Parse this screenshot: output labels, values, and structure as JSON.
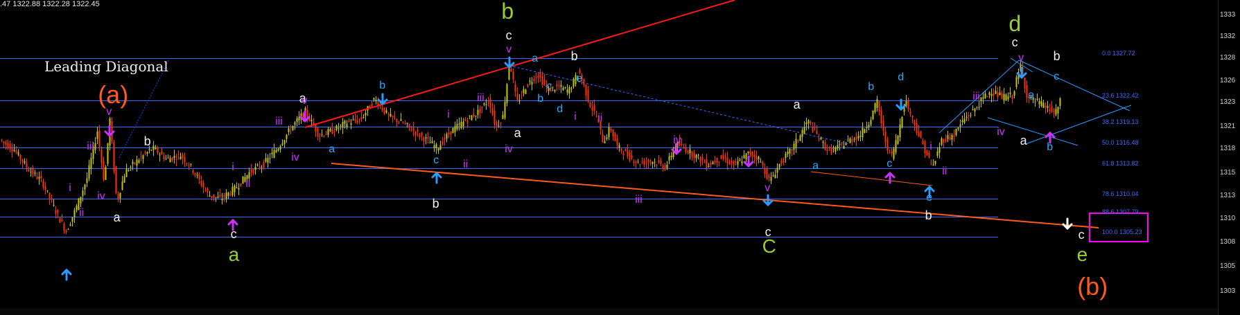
{
  "header": {
    "ohlc_text": ".47 1322.88 1322.28 1322.45"
  },
  "annotation": {
    "diagram_label": "Leading Diagonal"
  },
  "y_axis_ticks": [
    "1333",
    "1332",
    "1328",
    "1326",
    "1323",
    "1321",
    "1318",
    "1315",
    "1313",
    "1310",
    "1308",
    "1305",
    "1303"
  ],
  "fib_levels": [
    {
      "ratio": "0.0",
      "price": 1327.72,
      "label": "0.0 1327.72"
    },
    {
      "ratio": "23.6",
      "price": 1322.42,
      "label": "23.6 1322.42"
    },
    {
      "ratio": "38.2",
      "price": 1319.13,
      "label": "38.2 1319.13"
    },
    {
      "ratio": "50.0",
      "price": 1316.48,
      "label": "50.0 1316.48"
    },
    {
      "ratio": "61.8",
      "price": 1313.82,
      "label": "61.8 1313.82"
    },
    {
      "ratio": "78.6",
      "price": 1310.04,
      "label": "78.6 1310.04"
    },
    {
      "ratio": "88.6",
      "price": 1307.79,
      "label": "88.6 1307.79"
    },
    {
      "ratio": "100.0",
      "price": 1305.23,
      "label": "100.0 1305.23"
    }
  ],
  "wave_labels": [
    {
      "text": "(a)",
      "color": "#ff5a1f",
      "size": 36,
      "x": 152,
      "y": 150
    },
    {
      "text": "(b)",
      "color": "#ff5a1f",
      "size": 36,
      "x": 1565,
      "y": 427
    },
    {
      "text": "b",
      "color": "#9acd32",
      "size": 32,
      "x": 733,
      "y": 27
    },
    {
      "text": "d",
      "color": "#9acd32",
      "size": 32,
      "x": 1465,
      "y": 45
    },
    {
      "text": "a",
      "color": "#9acd32",
      "size": 28,
      "x": 338,
      "y": 378
    },
    {
      "text": "C",
      "color": "#9acd32",
      "size": 28,
      "x": 1108,
      "y": 366
    },
    {
      "text": "e",
      "color": "#9acd32",
      "size": 28,
      "x": 1562,
      "y": 378
    },
    {
      "text": "c",
      "color": "#f0f0f0",
      "size": 18,
      "x": 735,
      "y": 57
    },
    {
      "text": "b",
      "color": "#f0f0f0",
      "size": 18,
      "x": 829,
      "y": 87
    },
    {
      "text": "a",
      "color": "#f0f0f0",
      "size": 18,
      "x": 437,
      "y": 148
    },
    {
      "text": "b",
      "color": "#f0f0f0",
      "size": 18,
      "x": 213,
      "y": 210
    },
    {
      "text": "a",
      "color": "#f0f0f0",
      "size": 18,
      "x": 169,
      "y": 320
    },
    {
      "text": "c",
      "color": "#f0f0f0",
      "size": 18,
      "x": 338,
      "y": 344
    },
    {
      "text": "b",
      "color": "#f0f0f0",
      "size": 18,
      "x": 629,
      "y": 300
    },
    {
      "text": "a",
      "color": "#f0f0f0",
      "size": 18,
      "x": 747,
      "y": 198
    },
    {
      "text": "a",
      "color": "#f0f0f0",
      "size": 18,
      "x": 1150,
      "y": 157
    },
    {
      "text": "c",
      "color": "#f0f0f0",
      "size": 18,
      "x": 1109,
      "y": 341
    },
    {
      "text": "b",
      "color": "#f0f0f0",
      "size": 18,
      "x": 1340,
      "y": 317
    },
    {
      "text": "c",
      "color": "#f0f0f0",
      "size": 18,
      "x": 1465,
      "y": 67
    },
    {
      "text": "b",
      "color": "#f0f0f0",
      "size": 18,
      "x": 1525,
      "y": 87
    },
    {
      "text": "a",
      "color": "#f0f0f0",
      "size": 18,
      "x": 1477,
      "y": 209
    },
    {
      "text": "c",
      "color": "#f0f0f0",
      "size": 18,
      "x": 1561,
      "y": 345
    },
    {
      "text": "v",
      "color": "#cc33ff",
      "size": 16,
      "x": 158,
      "y": 168
    },
    {
      "text": "iii",
      "color": "#cc33ff",
      "size": 16,
      "x": 130,
      "y": 218
    },
    {
      "text": "i",
      "color": "#cc33ff",
      "size": 16,
      "x": 104,
      "y": 278
    },
    {
      "text": "iv",
      "color": "#cc33ff",
      "size": 16,
      "x": 145,
      "y": 290
    },
    {
      "text": "ii",
      "color": "#cc33ff",
      "size": 16,
      "x": 119,
      "y": 314
    },
    {
      "text": "v",
      "color": "#cc33ff",
      "size": 16,
      "x": 440,
      "y": 152
    },
    {
      "text": "iii",
      "color": "#cc33ff",
      "size": 16,
      "x": 402,
      "y": 182
    },
    {
      "text": "iv",
      "color": "#cc33ff",
      "size": 16,
      "x": 425,
      "y": 234
    },
    {
      "text": "i",
      "color": "#cc33ff",
      "size": 16,
      "x": 339,
      "y": 248
    },
    {
      "text": "ii",
      "color": "#cc33ff",
      "size": 16,
      "x": 359,
      "y": 272
    },
    {
      "text": "v",
      "color": "#cc33ff",
      "size": 16,
      "x": 735,
      "y": 78
    },
    {
      "text": "iii",
      "color": "#cc33ff",
      "size": 16,
      "x": 693,
      "y": 148
    },
    {
      "text": "i",
      "color": "#cc33ff",
      "size": 16,
      "x": 650,
      "y": 172
    },
    {
      "text": "ii",
      "color": "#cc33ff",
      "size": 16,
      "x": 673,
      "y": 244
    },
    {
      "text": "iv",
      "color": "#cc33ff",
      "size": 16,
      "x": 733,
      "y": 222
    },
    {
      "text": "i",
      "color": "#cc33ff",
      "size": 16,
      "x": 833,
      "y": 175
    },
    {
      "text": "ii",
      "color": "#cc33ff",
      "size": 16,
      "x": 867,
      "y": 177
    },
    {
      "text": "iv",
      "color": "#cc33ff",
      "size": 16,
      "x": 976,
      "y": 209
    },
    {
      "text": "iii",
      "color": "#cc33ff",
      "size": 16,
      "x": 921,
      "y": 295
    },
    {
      "text": "v",
      "color": "#cc33ff",
      "size": 16,
      "x": 1108,
      "y": 278
    },
    {
      "text": "iii",
      "color": "#cc33ff",
      "size": 16,
      "x": 1408,
      "y": 146
    },
    {
      "text": "iv",
      "color": "#cc33ff",
      "size": 16,
      "x": 1443,
      "y": 197
    },
    {
      "text": "i",
      "color": "#cc33ff",
      "size": 16,
      "x": 1346,
      "y": 218
    },
    {
      "text": "ii",
      "color": "#cc33ff",
      "size": 16,
      "x": 1364,
      "y": 254
    },
    {
      "text": "v",
      "color": "#cc33ff",
      "size": 16,
      "x": 1474,
      "y": 90
    },
    {
      "text": "b",
      "color": "#22aaff",
      "size": 16,
      "x": 552,
      "y": 130
    },
    {
      "text": "a",
      "color": "#22aaff",
      "size": 16,
      "x": 479,
      "y": 222
    },
    {
      "text": "c",
      "color": "#22aaff",
      "size": 16,
      "x": 630,
      "y": 238
    },
    {
      "text": "a",
      "color": "#22aaff",
      "size": 16,
      "x": 772,
      "y": 91
    },
    {
      "text": "c",
      "color": "#22aaff",
      "size": 16,
      "x": 793,
      "y": 131
    },
    {
      "text": "e",
      "color": "#22aaff",
      "size": 16,
      "x": 836,
      "y": 120
    },
    {
      "text": "b",
      "color": "#22aaff",
      "size": 16,
      "x": 780,
      "y": 149
    },
    {
      "text": "d",
      "color": "#22aaff",
      "size": 16,
      "x": 808,
      "y": 164
    },
    {
      "text": "b",
      "color": "#22aaff",
      "size": 16,
      "x": 1257,
      "y": 132
    },
    {
      "text": "d",
      "color": "#22aaff",
      "size": 16,
      "x": 1300,
      "y": 118
    },
    {
      "text": "a",
      "color": "#22aaff",
      "size": 16,
      "x": 1177,
      "y": 246
    },
    {
      "text": "c",
      "color": "#22aaff",
      "size": 16,
      "x": 1284,
      "y": 243
    },
    {
      "text": "e",
      "color": "#22aaff",
      "size": 16,
      "x": 1341,
      "y": 292
    },
    {
      "text": "a",
      "color": "#22aaff",
      "size": 16,
      "x": 1488,
      "y": 144
    },
    {
      "text": "c",
      "color": "#22aaff",
      "size": 16,
      "x": 1525,
      "y": 117
    },
    {
      "text": "b",
      "color": "#22aaff",
      "size": 16,
      "x": 1515,
      "y": 219
    }
  ],
  "chart_data": {
    "type": "candlestick",
    "title": "",
    "xlabel": "",
    "ylabel": "",
    "ylim": [
      1302.5,
      1333.5
    ],
    "grid": false,
    "legend": "none",
    "colors": {
      "background": "#000000",
      "candle_up": "#c8c800",
      "candle_down": "#ff3300",
      "fib_line": "#3d6cff",
      "channel_upper": "#ff1a1a",
      "channel_lower": "#ff5a1f",
      "triangle_lines": "#2a9bff",
      "arrow_magenta": "#cc33ff",
      "arrow_blue": "#2a9bff",
      "target_box": "#ff00ff"
    },
    "price_path": [
      [
        0,
        1317.4
      ],
      [
        20,
        1316.2
      ],
      [
        40,
        1313.8
      ],
      [
        60,
        1312.2
      ],
      [
        80,
        1308.4
      ],
      [
        95,
        1305.9
      ],
      [
        110,
        1309.0
      ],
      [
        125,
        1312.6
      ],
      [
        140,
        1318.6
      ],
      [
        150,
        1312.0
      ],
      [
        158,
        1320.0
      ],
      [
        168,
        1309.6
      ],
      [
        180,
        1313.4
      ],
      [
        200,
        1315.0
      ],
      [
        220,
        1316.4
      ],
      [
        240,
        1315.0
      ],
      [
        260,
        1315.5
      ],
      [
        275,
        1314.0
      ],
      [
        300,
        1310.5
      ],
      [
        318,
        1310.0
      ],
      [
        340,
        1311.4
      ],
      [
        360,
        1313.4
      ],
      [
        380,
        1314.4
      ],
      [
        400,
        1316.4
      ],
      [
        420,
        1319.0
      ],
      [
        440,
        1321.0
      ],
      [
        460,
        1318.0
      ],
      [
        480,
        1318.6
      ],
      [
        500,
        1319.6
      ],
      [
        520,
        1320.0
      ],
      [
        540,
        1322.6
      ],
      [
        560,
        1320.4
      ],
      [
        580,
        1319.6
      ],
      [
        600,
        1318.3
      ],
      [
        615,
        1317.4
      ],
      [
        630,
        1316.4
      ],
      [
        650,
        1318.5
      ],
      [
        670,
        1319.8
      ],
      [
        690,
        1321.0
      ],
      [
        705,
        1322.5
      ],
      [
        715,
        1319.0
      ],
      [
        725,
        1320.4
      ],
      [
        735,
        1327.4
      ],
      [
        745,
        1322.0
      ],
      [
        760,
        1324.4
      ],
      [
        775,
        1325.7
      ],
      [
        790,
        1323.7
      ],
      [
        805,
        1324.1
      ],
      [
        820,
        1323.6
      ],
      [
        835,
        1326.1
      ],
      [
        850,
        1322.0
      ],
      [
        860,
        1320.4
      ],
      [
        870,
        1317.1
      ],
      [
        880,
        1319.0
      ],
      [
        890,
        1316.6
      ],
      [
        905,
        1315.5
      ],
      [
        920,
        1314.5
      ],
      [
        940,
        1314.8
      ],
      [
        960,
        1314.0
      ],
      [
        975,
        1317.0
      ],
      [
        990,
        1316.2
      ],
      [
        1005,
        1315.3
      ],
      [
        1020,
        1314.3
      ],
      [
        1040,
        1315.2
      ],
      [
        1060,
        1314.2
      ],
      [
        1080,
        1315.8
      ],
      [
        1095,
        1315.0
      ],
      [
        1110,
        1312.2
      ],
      [
        1125,
        1314.5
      ],
      [
        1140,
        1316.0
      ],
      [
        1155,
        1318.2
      ],
      [
        1165,
        1319.8
      ],
      [
        1180,
        1317.8
      ],
      [
        1195,
        1316.0
      ],
      [
        1210,
        1316.5
      ],
      [
        1225,
        1317.4
      ],
      [
        1240,
        1318.0
      ],
      [
        1255,
        1320.0
      ],
      [
        1265,
        1322.3
      ],
      [
        1275,
        1317.8
      ],
      [
        1285,
        1315.2
      ],
      [
        1295,
        1318.0
      ],
      [
        1305,
        1322.6
      ],
      [
        1318,
        1319.6
      ],
      [
        1330,
        1317.0
      ],
      [
        1345,
        1313.9
      ],
      [
        1358,
        1317.4
      ],
      [
        1375,
        1318.0
      ],
      [
        1390,
        1320.0
      ],
      [
        1405,
        1321.2
      ],
      [
        1418,
        1322.7
      ],
      [
        1430,
        1323.6
      ],
      [
        1445,
        1322.8
      ],
      [
        1460,
        1323.0
      ],
      [
        1472,
        1326.8
      ],
      [
        1482,
        1322.7
      ],
      [
        1496,
        1322.2
      ],
      [
        1510,
        1321.5
      ],
      [
        1522,
        1320.7
      ],
      [
        1530,
        1322.45
      ]
    ]
  }
}
